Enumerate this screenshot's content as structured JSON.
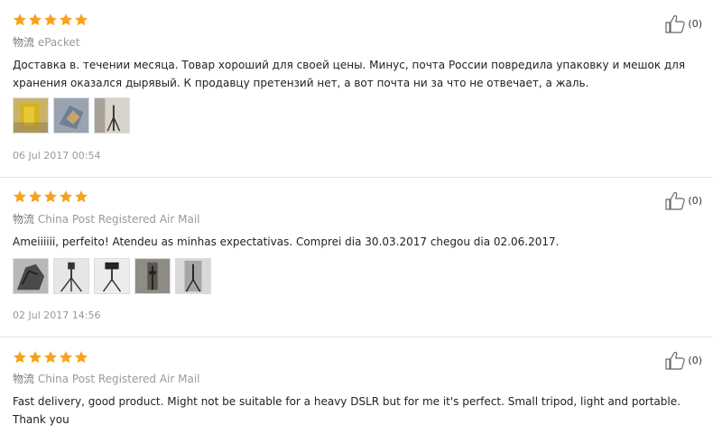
{
  "reviews": [
    {
      "shipping_prefix": "物流",
      "shipping": "ePacket",
      "text": "Доставка в. течении месяца. Товар хороший для своей цены. Минус, почта России повредила упаковку и мешок для хранения оказался дырявый. К продавцу претензий нет, а вот почта ни за что не отвечает, а жаль.",
      "date": "06 Jul 2017 00:54",
      "likes": "(0)",
      "rating": 5,
      "photos": 3
    },
    {
      "shipping_prefix": "物流",
      "shipping": "China Post Registered Air Mail",
      "text": "Ameiiiiii, perfeito! Atendeu as minhas expectativas. Comprei dia 30.03.2017 chegou dia 02.06.2017.",
      "date": "02 Jul 2017 14:56",
      "likes": "(0)",
      "rating": 5,
      "photos": 5
    },
    {
      "shipping_prefix": "物流",
      "shipping": "China Post Registered Air Mail",
      "text": "Fast delivery, good product. Might not be suitable for a heavy DSLR but for me it's perfect. Small tripod, light and portable. Thank you",
      "likes": "(0)",
      "rating": 5
    }
  ],
  "colors": {
    "star": "#f6a21c",
    "accent": "#f60"
  },
  "icons": {
    "star": "star-icon",
    "like": "thumbs-up-icon"
  }
}
